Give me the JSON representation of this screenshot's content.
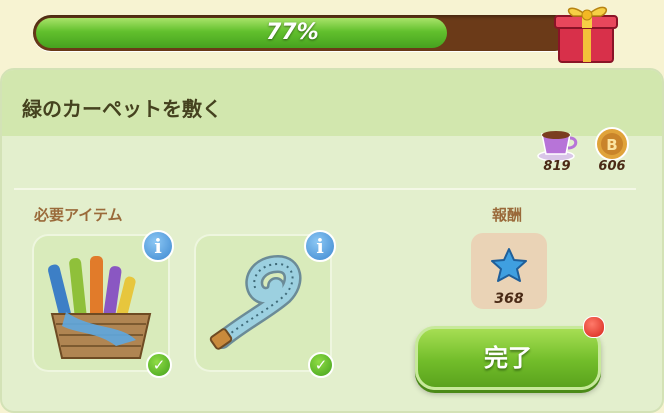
{
  "progress": {
    "value": 0.77,
    "label": "77%"
  },
  "quest": {
    "title": "緑のカーペットを敷く"
  },
  "currencies": [
    {
      "icon": "teacup-icon",
      "amount": "819"
    },
    {
      "icon": "coin-icon",
      "amount": "606"
    }
  ],
  "requirements": {
    "label": "必要アイテム",
    "items": [
      {
        "icon": "fabric-basket-icon",
        "completed": true
      },
      {
        "icon": "measuring-tape-icon",
        "completed": true
      }
    ]
  },
  "reward": {
    "label": "報酬",
    "icon": "blue-star-icon",
    "amount": "368"
  },
  "buttons": {
    "complete_label": "完了"
  },
  "colors": {
    "progress_fill": "#62c02d",
    "button_green": "#72bd2a",
    "panel": "#e3efcd"
  }
}
